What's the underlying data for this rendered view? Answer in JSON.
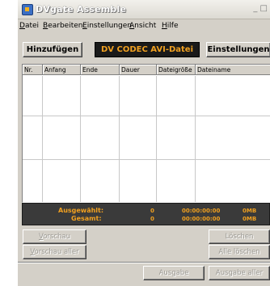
{
  "window": {
    "title": "DVgate Assemble",
    "controls": "_ □"
  },
  "menu": [
    {
      "first": "D",
      "rest": "atei"
    },
    {
      "first": "B",
      "rest": "earbeiten"
    },
    {
      "first": "E",
      "rest": "instellungen"
    },
    {
      "first": "A",
      "rest": "nsicht"
    },
    {
      "first": "H",
      "rest": "ilfe"
    }
  ],
  "toolbar": {
    "add_label": "Hinzufügen",
    "codec_label": "DV CODEC AVI-Datei",
    "settings_label": "Einstellungen"
  },
  "list": {
    "columns": [
      "Nr.",
      "Anfang",
      "Ende",
      "Dauer",
      "Dateigröße",
      "Dateiname"
    ]
  },
  "status": {
    "selected_label": "Ausgewählt:",
    "total_label": "Gesamt:",
    "selected_count": "0",
    "selected_time": "00:00:00:00",
    "selected_size": "0MB",
    "total_count": "0",
    "total_time": "00:00:00:00",
    "total_size": "0MB"
  },
  "buttons": {
    "preview": {
      "first": "V",
      "rest": "orschau"
    },
    "preview_all": {
      "first": "V",
      "rest": "orschau aller"
    },
    "delete": "Löschen",
    "delete_all": "Alle löschen",
    "output": "Ausgabe",
    "output_all": "Ausgabe aller"
  }
}
